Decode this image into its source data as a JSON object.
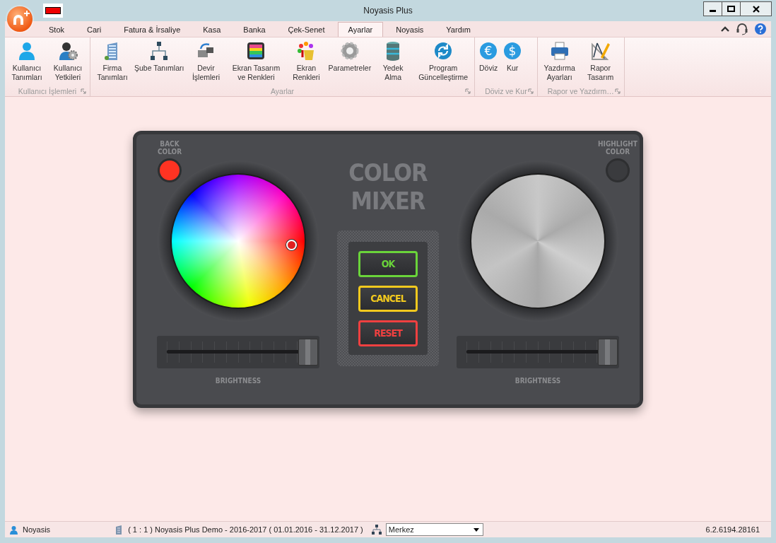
{
  "window": {
    "title": "Noyasis Plus"
  },
  "tabs": [
    {
      "label": "Stok",
      "selected": false
    },
    {
      "label": "Cari",
      "selected": false
    },
    {
      "label": "Fatura & İrsaliye",
      "selected": false
    },
    {
      "label": "Kasa",
      "selected": false
    },
    {
      "label": "Banka",
      "selected": false
    },
    {
      "label": "Çek-Senet",
      "selected": false
    },
    {
      "label": "Ayarlar",
      "selected": true
    },
    {
      "label": "Noyasis",
      "selected": false
    },
    {
      "label": "Yardım",
      "selected": false
    }
  ],
  "ribbon": {
    "groups": [
      {
        "label": "Kullanıcı İşlemleri",
        "items": [
          {
            "label": "Kullanıcı Tanımları"
          },
          {
            "label": "Kullanıcı Yetkileri"
          }
        ]
      },
      {
        "label": "Ayarlar",
        "items": [
          {
            "label": "Firma Tanımları"
          },
          {
            "label": "Şube Tanımları"
          },
          {
            "label": "Devir İşlemleri"
          },
          {
            "label": "Ekran Tasarım ve Renkleri"
          },
          {
            "label": "Ekran Renkleri"
          },
          {
            "label": "Parametreler"
          },
          {
            "label": "Yedek Alma"
          },
          {
            "label": "Program Güncelleştirme"
          }
        ]
      },
      {
        "label": "Döviz ve Kur",
        "items": [
          {
            "label": "Döviz",
            "glyph": "€"
          },
          {
            "label": "Kur",
            "glyph": "$"
          }
        ]
      },
      {
        "label": "Rapor ve Yazdırm…",
        "items": [
          {
            "label": "Yazdırma Ayarları"
          },
          {
            "label": "Rapor Tasarım"
          }
        ]
      }
    ]
  },
  "mixer": {
    "title": "COLOR MIXER",
    "swatches": [
      {
        "label": "BACK COLOR",
        "color": "#ff3322"
      },
      {
        "label": "HIGHLIGHT COLOR",
        "color": "#3a3b3e"
      }
    ],
    "buttons": [
      {
        "label": "OK",
        "color": "#6ad43a"
      },
      {
        "label": "CANCEL",
        "color": "#f2c91e"
      },
      {
        "label": "RESET",
        "color": "#f04040"
      }
    ],
    "sliders": [
      {
        "label": "BRIGHTNESS",
        "level": 0.93
      },
      {
        "label": "BRIGHTNESS",
        "level": 0.93
      }
    ]
  },
  "status_bar": {
    "user": "Noyasis",
    "company": "( 1 : 1 )  Noyasis Plus Demo - 2016-2017  ( 01.01.2016 - 31.12.2017 )",
    "branch": "Merkez",
    "version": "6.2.6194.28161"
  }
}
